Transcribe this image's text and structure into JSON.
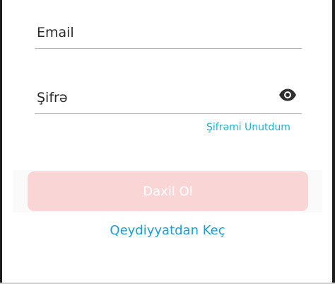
{
  "form": {
    "email": {
      "placeholder": "Email",
      "value": ""
    },
    "password": {
      "placeholder": "Şifrə",
      "value": "",
      "toggle_icon": "eye-icon"
    },
    "forgot_link": "Şifrəmi Unutdum",
    "login_button": "Daxil Ol",
    "login_button_state": "disabled",
    "register_link": "Qeydiyyatdan Keç"
  },
  "colors": {
    "link": "#1db3cf",
    "register_link": "#1a9fd6",
    "button_disabled_bg": "#f9d5d6",
    "button_text": "#ffffff",
    "field_underline": "#b5b5b5"
  }
}
